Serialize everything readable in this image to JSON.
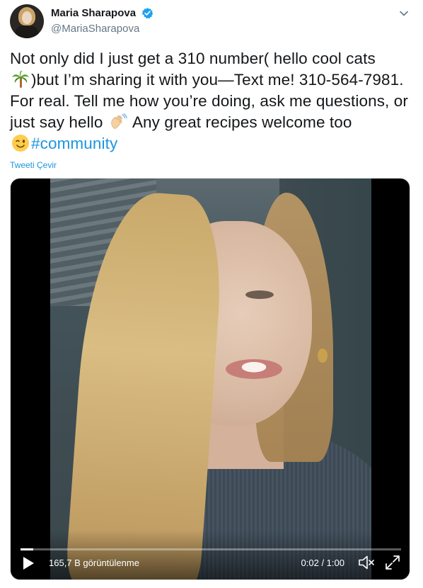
{
  "author": {
    "display_name": "Maria Sharapova",
    "handle": "@MariaSharapova",
    "verified": true,
    "avatar_icon": "profile-photo"
  },
  "menu_icon": "chevron-down-icon",
  "tweet": {
    "lines": [
      "Not only did I just get a 310 number( hello cool cats",
      ")but I’m sharing it with you—Text me! 310-564-7981.",
      "For real. Tell me how you’re doing, ask me questions, or",
      "just say hello",
      "Any great recipes welcome too"
    ],
    "emojis": [
      "palm-tree",
      "waving-hand",
      "winking-face"
    ],
    "hashtag": "#community",
    "hashtag_color": "#1b95e0"
  },
  "translate_link": "Tweeti Çevir",
  "video": {
    "views": "165,7 B görüntülenme",
    "time": "0:02 / 1:00",
    "progress": 0.033,
    "icons": [
      "play-icon",
      "mute-icon",
      "fullscreen-icon"
    ]
  },
  "colors": {
    "text": "#14171a",
    "muted": "#657786",
    "link": "#1b95e0",
    "verified": "#1da1f2"
  }
}
